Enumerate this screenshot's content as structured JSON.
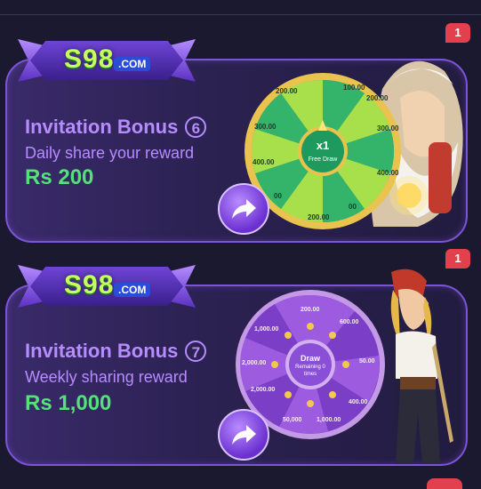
{
  "cards": [
    {
      "logo": {
        "brand": "S98",
        "domain": ".COM"
      },
      "title": "Invitation Bonus",
      "number": "6",
      "subtitle": "Daily share your reward",
      "amount": "Rs 200",
      "badge": "1",
      "wheel": {
        "center_top": "x1",
        "center_bottom": "Free Draw",
        "segments": [
          "100.00",
          "200.00",
          "300.00",
          "400.00",
          "00",
          "200.00",
          "00",
          "400.00",
          "300.00",
          "200.00"
        ]
      }
    },
    {
      "logo": {
        "brand": "S98",
        "domain": ".COM"
      },
      "title": "Invitation Bonus",
      "number": "7",
      "subtitle": "Weekly sharing reward",
      "amount": "Rs 1,000",
      "badge": "1",
      "wheel": {
        "center_top": "Draw",
        "center_bottom": "Remaining 0 times",
        "segments": [
          "200.00",
          "600.00",
          "50.00",
          "400.00",
          "1,000.00",
          "50,000",
          "2,000.00",
          "2,000.00",
          "1,000.00"
        ]
      }
    }
  ],
  "colors": {
    "accent": "#b68cff",
    "amount": "#54e07a",
    "badge": "#e2404c",
    "background": "#1b1930"
  }
}
